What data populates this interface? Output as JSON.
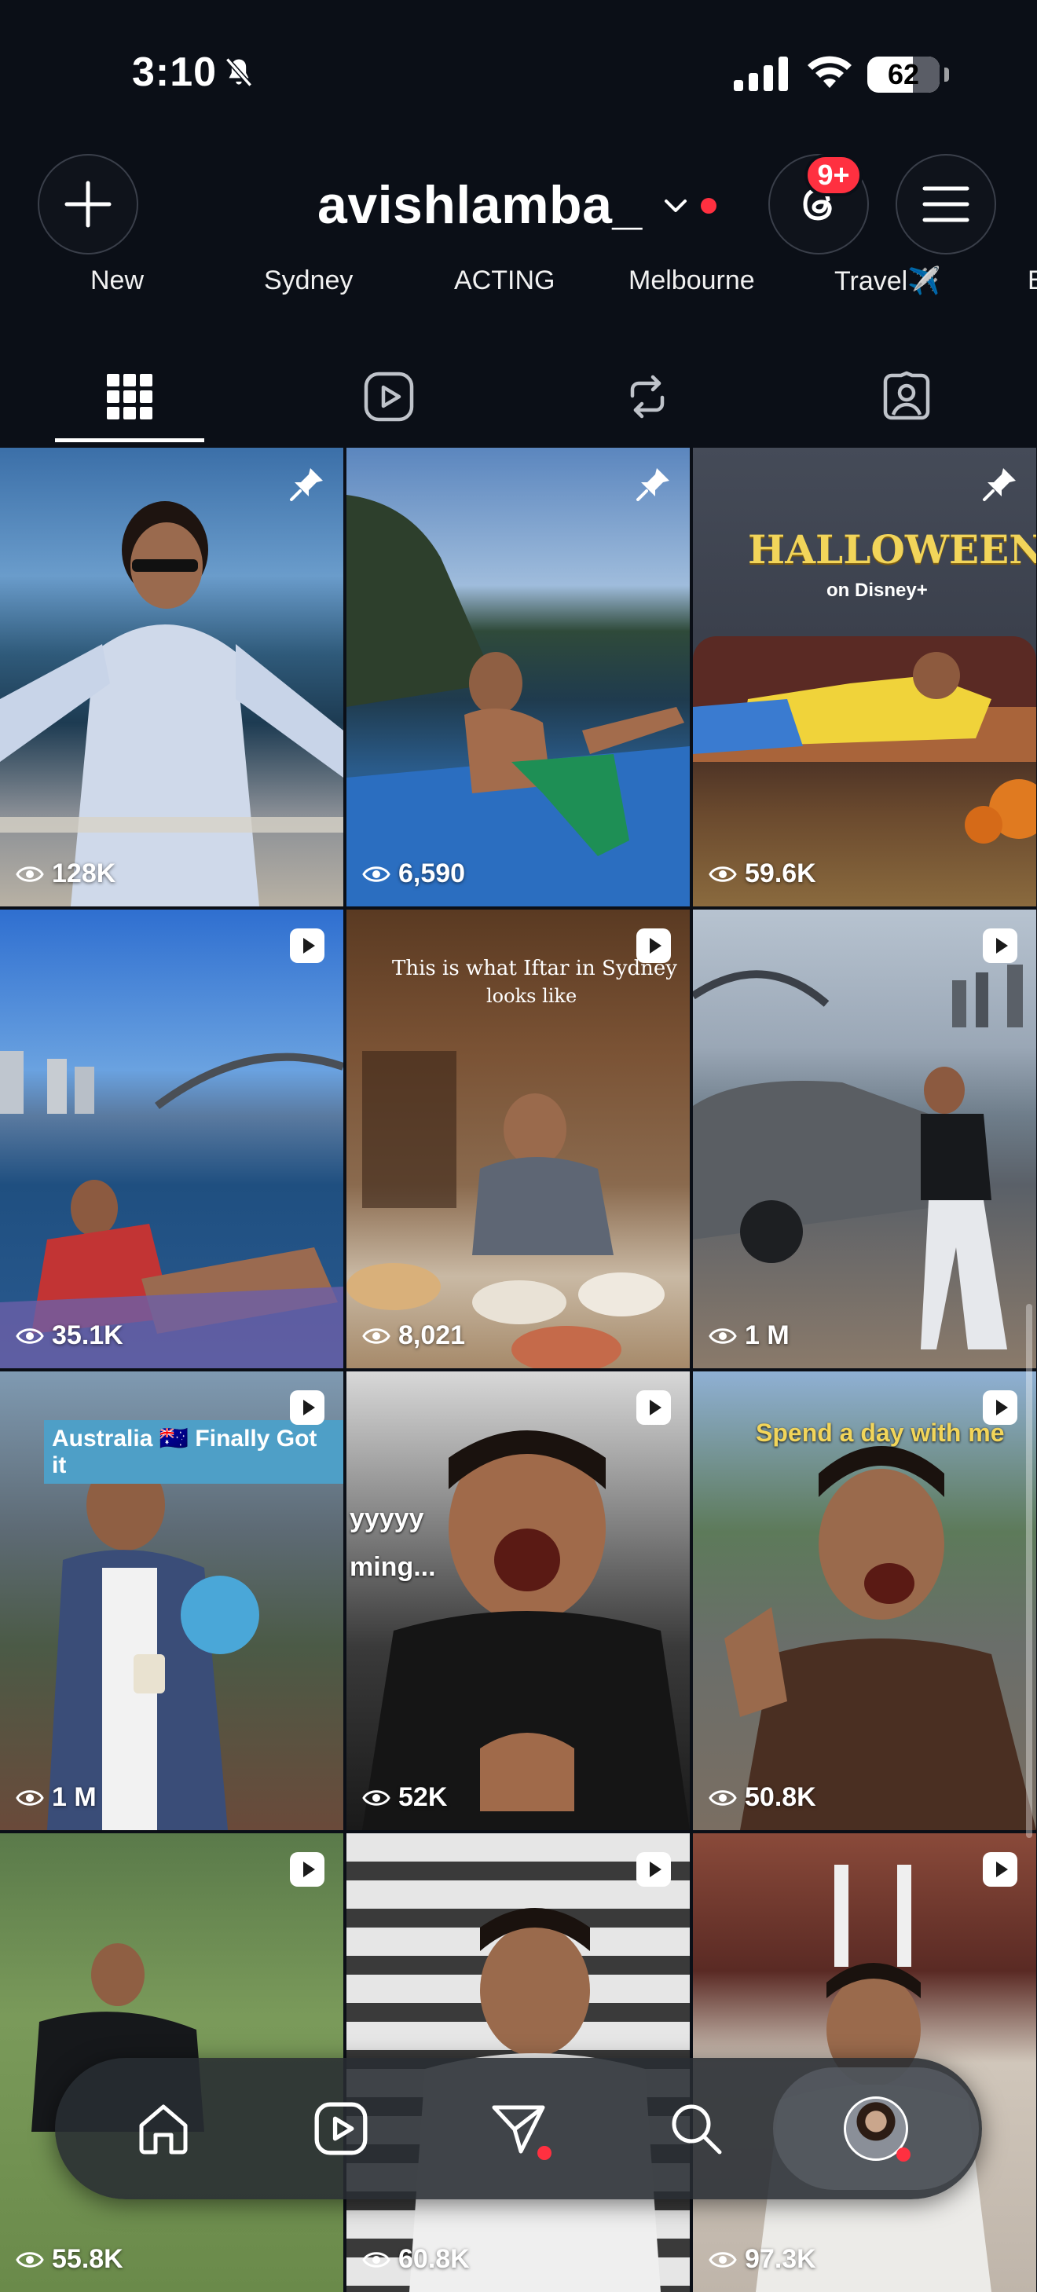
{
  "status_bar": {
    "time": "3:10",
    "battery": "62"
  },
  "header": {
    "username": "avishlamba_",
    "threads_badge": "9+",
    "new_label": "New"
  },
  "highlights": [
    "New",
    "Sydney",
    "ACTING",
    "Melbourne",
    "Travel✈️",
    "E"
  ],
  "tabs": [
    "posts-grid",
    "reels",
    "reposts",
    "tagged"
  ],
  "grid": {
    "tiles": [
      {
        "views": "128K",
        "type": "pinned"
      },
      {
        "views": "6,590",
        "type": "pinned"
      },
      {
        "views": "59.6K",
        "type": "pinned",
        "caption": "HALLOWEEN",
        "subcaption": "on Disney+"
      },
      {
        "views": "35.1K",
        "type": "reel"
      },
      {
        "views": "8,021",
        "type": "reel",
        "caption": "This is what Iftar in Sydney",
        "subcaption": "looks like"
      },
      {
        "views": "1 M",
        "type": "reel"
      },
      {
        "views": "1 M",
        "type": "reel",
        "caption": "Australia 🇦🇺 Finally Got it"
      },
      {
        "views": "52K",
        "type": "reel",
        "caption": "yyyyy",
        "subcaption": "ming..."
      },
      {
        "views": "50.8K",
        "type": "reel",
        "caption": "Spend a day with me"
      },
      {
        "views": "55.8K",
        "type": "reel"
      },
      {
        "views": "60.8K",
        "type": "reel"
      },
      {
        "views": "97.3K",
        "type": "reel"
      }
    ]
  },
  "bottom_nav": [
    "home",
    "reels",
    "messages",
    "search",
    "profile"
  ],
  "colors": {
    "background": "#0b0f17",
    "notification": "#ff3040"
  }
}
